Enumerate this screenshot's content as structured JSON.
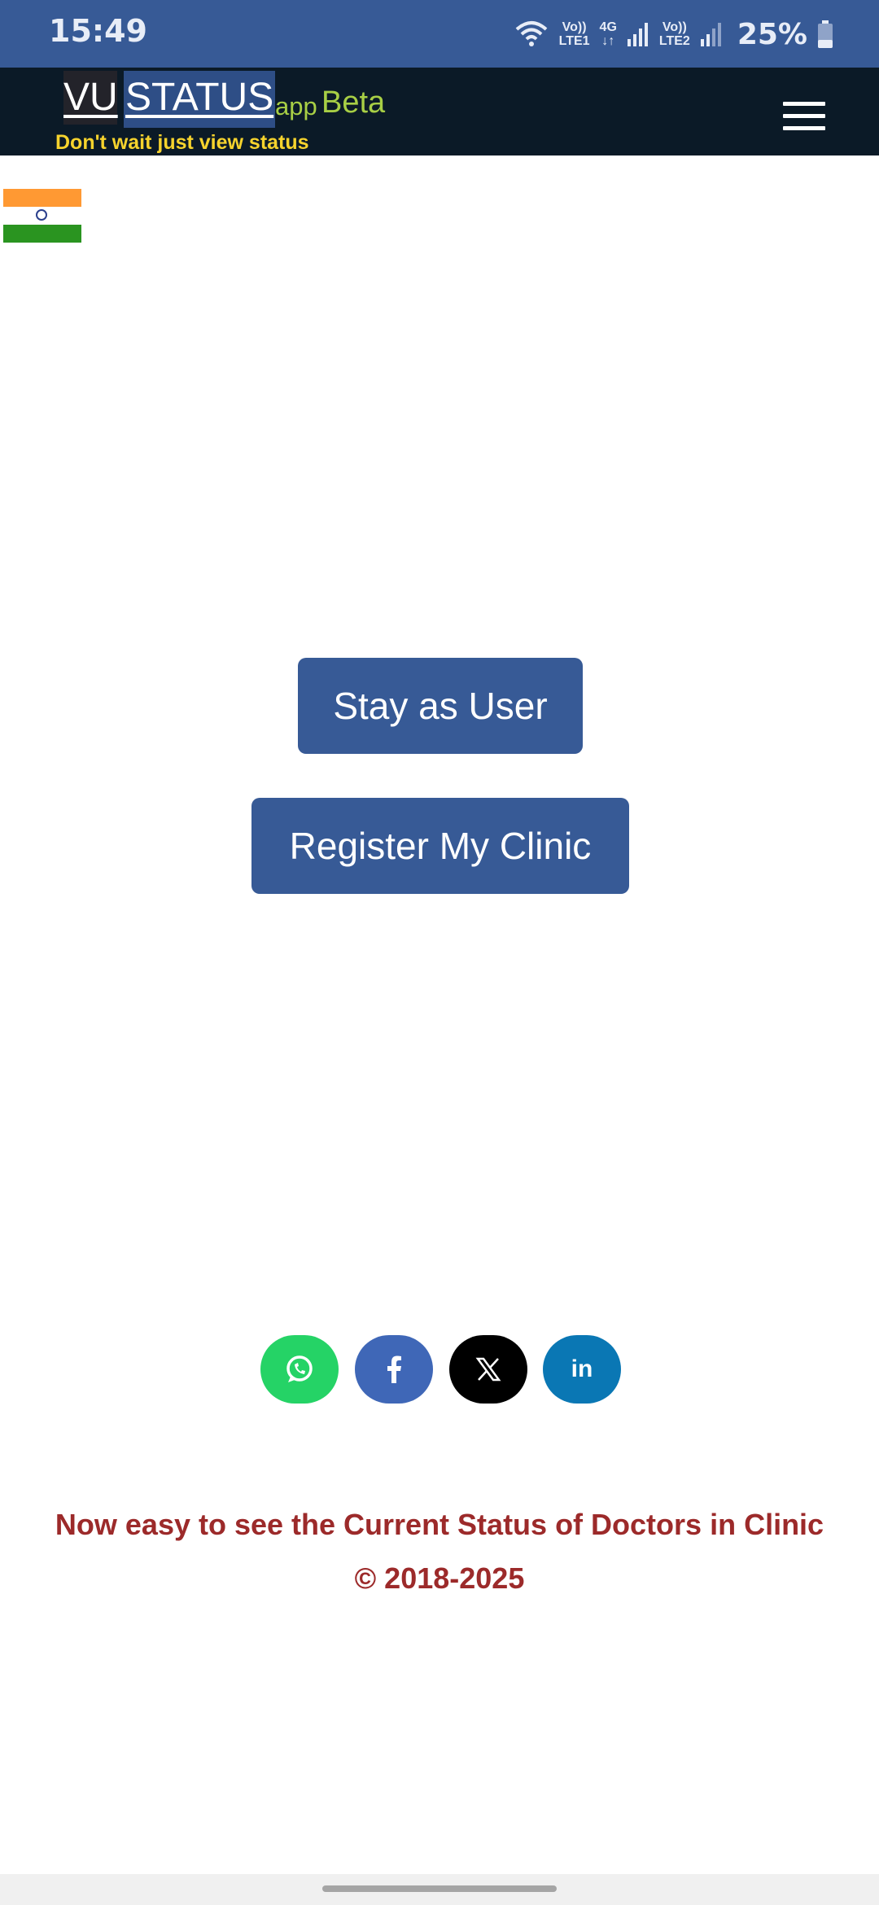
{
  "status_bar": {
    "time": "15:49",
    "sim1_tag_top": "Vo))",
    "sim1_tag_bottom": "LTE1",
    "net_tag_top": "4G",
    "net_tag_bottom": "↓↑",
    "sim2_tag_top": "Vo))",
    "sim2_tag_bottom": "LTE2",
    "battery": "25%",
    "icons": [
      "wifi-icon",
      "signal-icon",
      "signal-icon",
      "battery-icon"
    ]
  },
  "header": {
    "logo_vu": "VU",
    "logo_status": "STATUS",
    "logo_app": "app",
    "logo_beta": "Beta",
    "tagline": "Don't wait just view status",
    "menu_icon": "hamburger-menu-icon"
  },
  "flag": {
    "icon": "india-flag-icon"
  },
  "actions": {
    "stay_user": "Stay as User",
    "register_clinic": "Register My Clinic"
  },
  "social": [
    {
      "name": "whatsapp",
      "icon": "whatsapp-icon",
      "color": "#25D366"
    },
    {
      "name": "facebook",
      "icon": "facebook-icon",
      "color": "#3F67B7"
    },
    {
      "name": "x",
      "icon": "x-icon",
      "color": "#000000"
    },
    {
      "name": "linkedin",
      "icon": "linkedin-icon",
      "color": "#0A77B4",
      "label": "in"
    }
  ],
  "footer": {
    "tagline": "Now easy to see the Current Status of Doctors in Clinic",
    "copyright": "© 2018-2025"
  },
  "colors": {
    "status_bar": "#375A96",
    "header_bg": "#0B1A27",
    "button_bg": "#375A96",
    "tagline_yellow": "#F6D32D",
    "beta_green": "#A8CF45",
    "footer_red": "#9C2A2A"
  }
}
